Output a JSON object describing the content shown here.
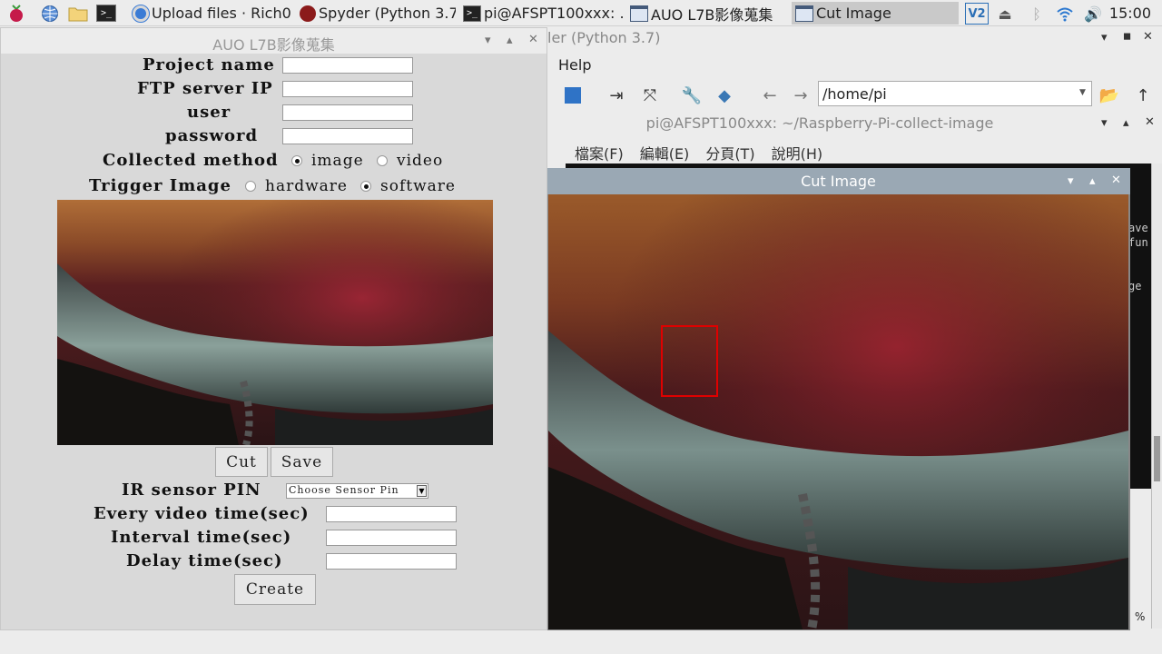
{
  "taskbar": {
    "tasks": [
      {
        "label": "Upload files · Rich0..."
      },
      {
        "label": "Spyder (Python 3.7)"
      },
      {
        "label": "pi@AFSPT100xxx: ..."
      },
      {
        "label": "AUO L7B影像蒐集"
      },
      {
        "label": "Cut Image"
      }
    ],
    "clock": "15:00",
    "terminal_glyph": ">_"
  },
  "spyder": {
    "title_fragment": "ler (Python 3.7)",
    "menu_help": "Help",
    "path": "/home/pi"
  },
  "terminal": {
    "title": "pi@AFSPT100xxx: ~/Raspberry-Pi-collect-image",
    "menu": [
      "檔案(F)",
      "編輯(E)",
      "分頁(T)",
      "說明(H)"
    ],
    "side_text": [
      "ave",
      "fun",
      "ge"
    ],
    "status": "%"
  },
  "cut_window": {
    "title": "Cut Image"
  },
  "app": {
    "title": "AUO L7B影像蒐集",
    "labels": {
      "project_name": "Project name",
      "ftp_server_ip": "FTP server IP",
      "user": "user",
      "password": "password",
      "collected_method": "Collected method",
      "trigger_image": "Trigger Image",
      "ir_sensor_pin": "IR sensor PIN",
      "every_video_time": "Every video time(sec)",
      "interval_time": "Interval time(sec)",
      "delay_time": "Delay time(sec)"
    },
    "fields": {
      "project_name": "",
      "ftp_server_ip": "",
      "user": "",
      "password": "",
      "every_video_time": "",
      "interval_time": "",
      "delay_time": ""
    },
    "collected_method": {
      "options": [
        "image",
        "video"
      ],
      "selected": "image"
    },
    "trigger_image": {
      "options": [
        "hardware",
        "software"
      ],
      "selected": "software"
    },
    "sensor_select": "Choose Sensor Pin",
    "buttons": {
      "cut": "Cut",
      "save": "Save",
      "create": "Create"
    }
  }
}
